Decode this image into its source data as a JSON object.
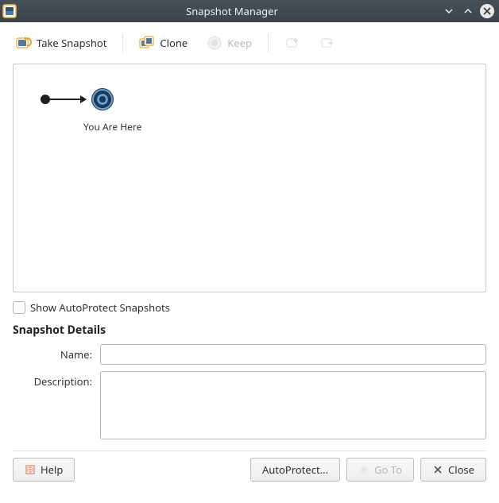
{
  "window": {
    "title": "Snapshot Manager"
  },
  "toolbar": {
    "take_snapshot": "Take Snapshot",
    "clone": "Clone",
    "keep": "Keep"
  },
  "tree": {
    "current_label": "You Are Here"
  },
  "autoprotect_checkbox": "Show AutoProtect Snapshots",
  "details": {
    "heading": "Snapshot Details",
    "name_label": "Name:",
    "description_label": "Description:",
    "name_value": "",
    "description_value": ""
  },
  "buttons": {
    "help": "Help",
    "autoprotect": "AutoProtect...",
    "goto": "Go To",
    "close": "Close"
  }
}
